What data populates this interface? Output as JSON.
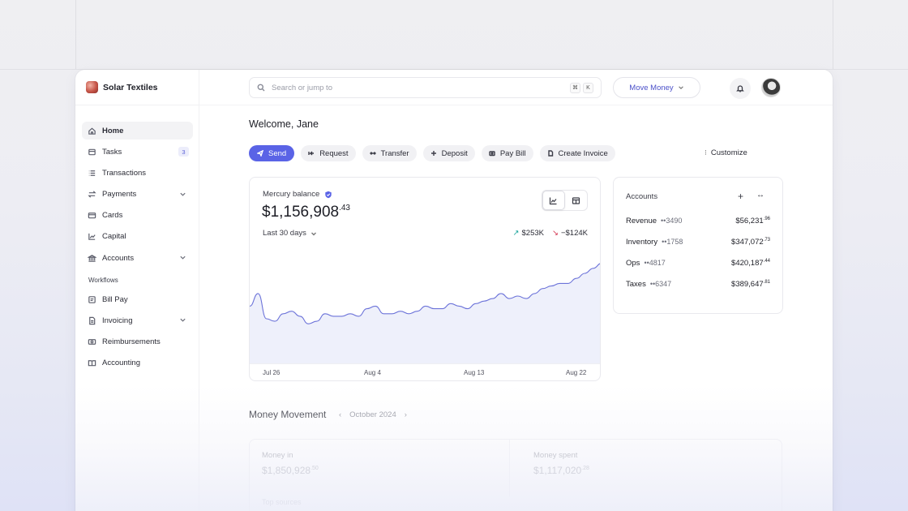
{
  "brand": {
    "name": "Solar Textiles"
  },
  "sidebar": {
    "items": [
      {
        "label": "Home"
      },
      {
        "label": "Tasks",
        "badge": "3"
      },
      {
        "label": "Transactions"
      },
      {
        "label": "Payments"
      },
      {
        "label": "Cards"
      },
      {
        "label": "Capital"
      },
      {
        "label": "Accounts"
      }
    ],
    "section_label": "Workflows",
    "workflow_items": [
      {
        "label": "Bill Pay"
      },
      {
        "label": "Invoicing"
      },
      {
        "label": "Reimbursements"
      },
      {
        "label": "Accounting"
      }
    ]
  },
  "search": {
    "placeholder": "Search or jump to",
    "shortcut_1": "⌘",
    "shortcut_2": "K"
  },
  "header": {
    "move_money_label": "Move Money"
  },
  "main": {
    "welcome": "Welcome, Jane",
    "actions": [
      "Send",
      "Request",
      "Transfer",
      "Deposit",
      "Pay Bill",
      "Create Invoice"
    ],
    "customize_label": "Customize"
  },
  "balance": {
    "label": "Mercury balance",
    "amount_main": "$1,156,908",
    "amount_cents": ".43",
    "period": "Last 30 days",
    "inflow": "$253K",
    "outflow": "−$124K"
  },
  "chart_data": {
    "type": "area",
    "x_ticks": [
      "Jul 26",
      "Aug 4",
      "Aug 13",
      "Aug 22"
    ],
    "values": [
      63,
      68,
      58,
      57,
      60,
      61,
      59,
      56,
      57,
      60,
      59,
      59,
      60,
      59,
      62,
      63,
      60,
      60,
      61,
      60,
      61,
      63,
      62,
      62,
      64,
      63,
      62,
      64,
      65,
      66,
      68,
      66,
      67,
      66,
      68,
      70,
      71,
      72,
      72,
      74,
      76,
      78,
      80
    ],
    "color": "#6c73d9",
    "fill_color": "#eef0fb",
    "ylim": [
      40,
      85
    ]
  },
  "accounts": {
    "title": "Accounts",
    "add_icon": "+",
    "expand_icon": "↔",
    "rows": [
      {
        "name": "Revenue",
        "mask": "••3490",
        "balance": "$56,231",
        "cents": ".96"
      },
      {
        "name": "Inventory",
        "mask": "••1758",
        "balance": "$347,072",
        "cents": ".73"
      },
      {
        "name": "Ops",
        "mask": "••4817",
        "balance": "$420,187",
        "cents": ".44"
      },
      {
        "name": "Taxes",
        "mask": "••6347",
        "balance": "$389,647",
        "cents": ".81"
      }
    ]
  },
  "money_movement": {
    "title": "Money Movement",
    "month": "October 2024",
    "in_label": "Money in",
    "in_value": "$1,850,928",
    "in_cents": ".50",
    "out_label": "Money spent",
    "out_value": "$1,117,020",
    "out_cents": ".28",
    "footer": "Top sources"
  },
  "colors": {
    "accent": "#5a63e6",
    "inflow": "#16a39a",
    "outflow": "#d43a55"
  }
}
